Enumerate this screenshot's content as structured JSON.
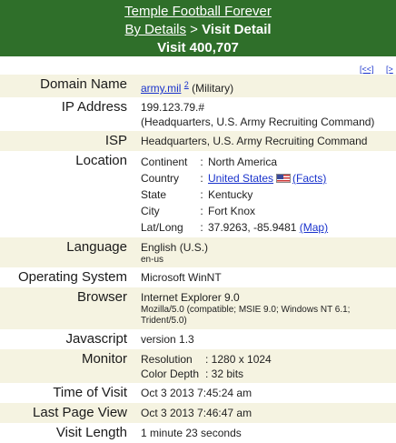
{
  "header": {
    "site_title": "Temple Football Forever",
    "breadcrumb_link": "By Details",
    "breadcrumb_sep": ">",
    "breadcrumb_current": "Visit Detail",
    "visit_title": "Visit 400,707"
  },
  "nav": {
    "prev": "[<<]",
    "next": "[>"
  },
  "rows": {
    "domain": {
      "label": "Domain Name",
      "link": "army.mil",
      "sup": "2",
      "note": "(Military)"
    },
    "ip": {
      "label": "IP Address",
      "value": "199.123.79.#",
      "org": "(Headquarters, U.S. Army Recruiting Command)"
    },
    "isp": {
      "label": "ISP",
      "value": "Headquarters, U.S. Army Recruiting Command"
    },
    "location": {
      "label": "Location",
      "continent_k": "Continent",
      "continent_v": "North America",
      "country_k": "Country",
      "country_v": "United States",
      "facts": "(Facts)",
      "state_k": "State",
      "state_v": "Kentucky",
      "city_k": "City",
      "city_v": "Fort Knox",
      "latlong_k": "Lat/Long",
      "latlong_v": "37.9263, -85.9481",
      "map": "(Map)"
    },
    "language": {
      "label": "Language",
      "value": "English (U.S.)",
      "code": "en-us"
    },
    "os": {
      "label": "Operating System",
      "value": "Microsoft WinNT"
    },
    "browser": {
      "label": "Browser",
      "value": "Internet Explorer 9.0",
      "ua": "Mozilla/5.0 (compatible; MSIE 9.0; Windows NT 6.1; Trident/5.0)"
    },
    "javascript": {
      "label": "Javascript",
      "value": "version 1.3"
    },
    "monitor": {
      "label": "Monitor",
      "res_k": "Resolution",
      "res_v": ": 1280 x 1024",
      "depth_k": "Color Depth",
      "depth_v": ": 32 bits"
    },
    "time_of_visit": {
      "label": "Time of Visit",
      "value": "Oct 3 2013 7:45:24 am"
    },
    "last_page_view": {
      "label": "Last Page View",
      "value": "Oct 3 2013 7:46:47 am"
    },
    "visit_length": {
      "label": "Visit Length",
      "value": "1 minute 23 seconds"
    }
  },
  "colors": {
    "header_bg": "#2f6f2a",
    "alt_row": "#f5f3e1",
    "link": "#1a33cc"
  },
  "icons": {
    "flag": "us-flag-icon"
  }
}
